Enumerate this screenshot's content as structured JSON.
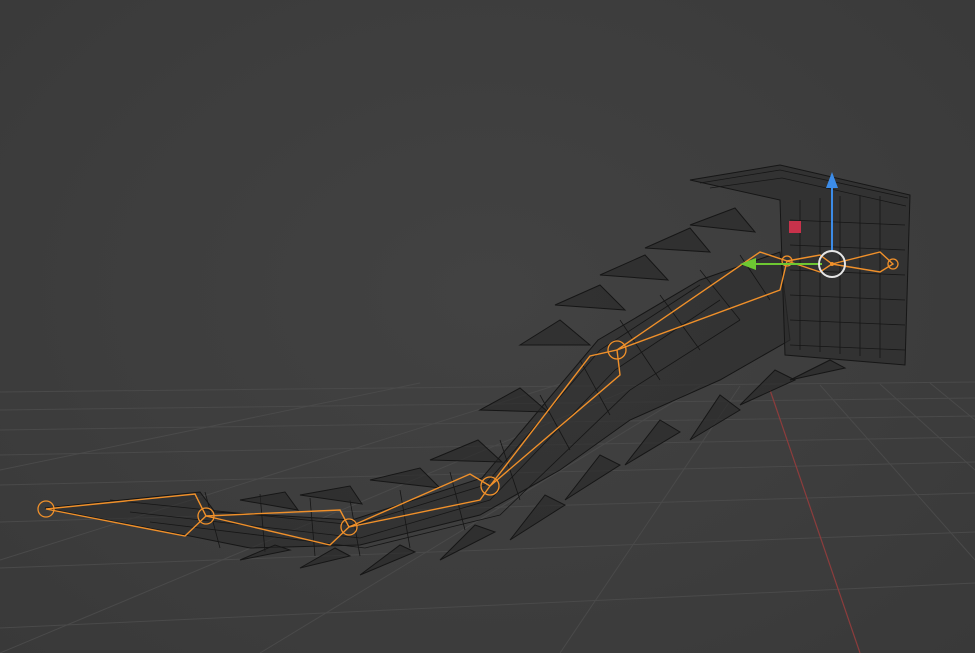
{
  "app": "3D viewport",
  "scene": {
    "mode": "wireframe",
    "selected_object": "tail-armature",
    "gizmo": "move",
    "bone_count": 7
  },
  "colors": {
    "background": "#3d3d3d",
    "grid": "#4a4a4a",
    "x_axis": "#8c3c3c",
    "wire": "#141414",
    "bone": "#f0902a",
    "gizmo_z": "#3c8ce8",
    "gizmo_y": "#6ec832",
    "gizmo_center": "#e6e6e6",
    "gizmo_x_handle": "#c8324b"
  }
}
